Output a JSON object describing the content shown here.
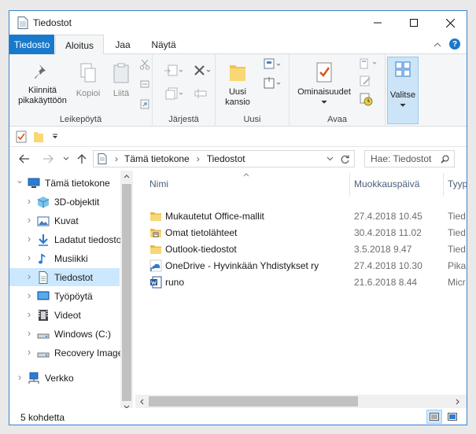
{
  "window": {
    "title": "Tiedostot"
  },
  "tabs": {
    "file": "Tiedosto",
    "home": "Aloitus",
    "share": "Jaa",
    "view": "Näytä"
  },
  "ribbon": {
    "pin_label_1": "Kiinnitä",
    "pin_label_2": "pikakäyttöön",
    "copy_label": "Kopioi",
    "paste_label": "Liitä",
    "clipboard_group": "Leikepöytä",
    "organize_group": "Järjestä",
    "new_folder_1": "Uusi",
    "new_folder_2": "kansio",
    "new_group": "Uusi",
    "properties_label": "Ominaisuudet",
    "open_group": "Avaa",
    "select_label": "Valitse"
  },
  "address": {
    "crumb_1": "Tämä tietokone",
    "crumb_2": "Tiedostot",
    "search_placeholder": "Hae: Tiedostot"
  },
  "nav": {
    "items": [
      {
        "label": "Tämä tietokone",
        "icon": "computer-icon"
      },
      {
        "label": "3D-objektit",
        "icon": "cube-icon"
      },
      {
        "label": "Kuvat",
        "icon": "pictures-icon"
      },
      {
        "label": "Ladatut tiedostot",
        "icon": "download-icon"
      },
      {
        "label": "Musiikki",
        "icon": "music-icon"
      },
      {
        "label": "Tiedostot",
        "icon": "documents-icon"
      },
      {
        "label": "Työpöytä",
        "icon": "desktop-icon"
      },
      {
        "label": "Videot",
        "icon": "video-icon"
      },
      {
        "label": "Windows (C:)",
        "icon": "drive-icon"
      },
      {
        "label": "Recovery Image",
        "icon": "drive-icon"
      },
      {
        "label": "Verkko",
        "icon": "network-icon"
      }
    ]
  },
  "list": {
    "columns": {
      "name": "Nimi",
      "modified": "Muokkauspäivä",
      "type": "Tyyp"
    },
    "rows": [
      {
        "name": "Mukautetut Office-mallit",
        "modified": "27.4.2018 10.45",
        "type": "Tied",
        "icon": "folder-icon"
      },
      {
        "name": "Omat tietolähteet",
        "modified": "30.4.2018 11.02",
        "type": "Tied",
        "icon": "datasource-folder-icon"
      },
      {
        "name": "Outlook-tiedostot",
        "modified": "3.5.2018 9.47",
        "type": "Tied",
        "icon": "folder-icon"
      },
      {
        "name": "OneDrive - Hyvinkään Yhdistykset ry",
        "modified": "27.4.2018 10.30",
        "type": "Pika",
        "icon": "onedrive-shortcut-icon"
      },
      {
        "name": "runo",
        "modified": "21.6.2018 8.44",
        "type": "Micr",
        "icon": "word-document-icon"
      }
    ]
  },
  "status": {
    "count": "5 kohdetta"
  },
  "colors": {
    "accent": "#1979ca",
    "selection": "#cce8ff",
    "folder": "#f8d775"
  }
}
